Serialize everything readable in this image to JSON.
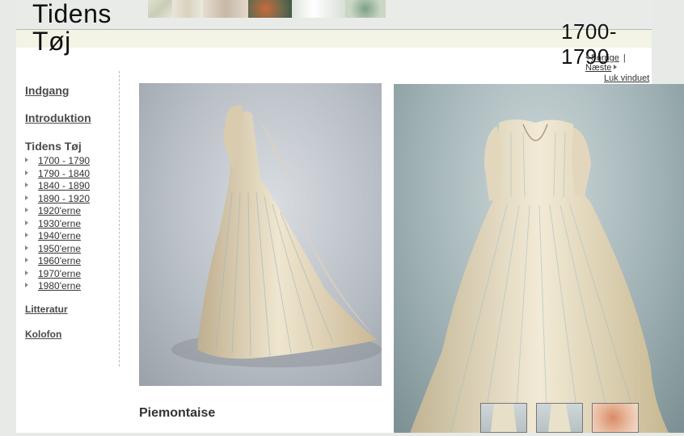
{
  "site": {
    "logo_line1": "Tidens",
    "logo_line2": "Tøj"
  },
  "header": {
    "period": "1700-1790"
  },
  "nav": {
    "previous": "Forrige",
    "separator": "|",
    "next": "Næste",
    "close_window": "Luk vinduet"
  },
  "sidebar": {
    "entrance": "Indgang",
    "introduction": "Introduktion",
    "section_title": "Tidens Tøj",
    "periods": [
      "1700 - 1790",
      "1790 - 1840",
      "1840 - 1890",
      "1890 - 1920",
      "1920'erne",
      "1930'erne",
      "1940'erne",
      "1950'erne",
      "1960'erne",
      "1970'erne",
      "1980'erne"
    ],
    "literature": "Litteratur",
    "colophon": "Kolofon"
  },
  "main": {
    "caption": "Piemontaise"
  },
  "colors": {
    "page": "#ffffff",
    "outer": "#e8eae7",
    "sidebar_text": "#4a4a4a"
  }
}
